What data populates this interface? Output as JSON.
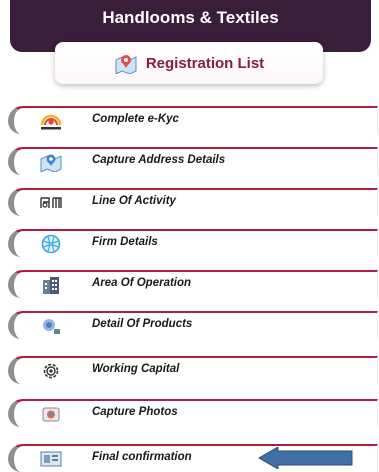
{
  "header": {
    "title": "Handlooms & Textiles"
  },
  "registration": {
    "label": "Registration List",
    "icon": "map-pin-icon"
  },
  "menu": [
    {
      "label": "Complete e-Kyc",
      "icon": "aadhaar-logo-icon"
    },
    {
      "label": "Capture Address Details",
      "icon": "map-pin-icon"
    },
    {
      "label": "Line Of Activity",
      "icon": "loom-icon"
    },
    {
      "label": "Firm Details",
      "icon": "globe-icon"
    },
    {
      "label": "Area Of Operation",
      "icon": "building-icon"
    },
    {
      "label": "Detail Of Products",
      "icon": "products-icon"
    },
    {
      "label": "Working Capital",
      "icon": "gear-icon"
    },
    {
      "label": "Capture Photos",
      "icon": "camera-icon"
    },
    {
      "label": "Final confirmation",
      "icon": "confirmation-icon"
    }
  ],
  "colors": {
    "header_bg": "#3a1d38",
    "accent": "#b01d3e",
    "arrow": "#3f6fa3"
  }
}
